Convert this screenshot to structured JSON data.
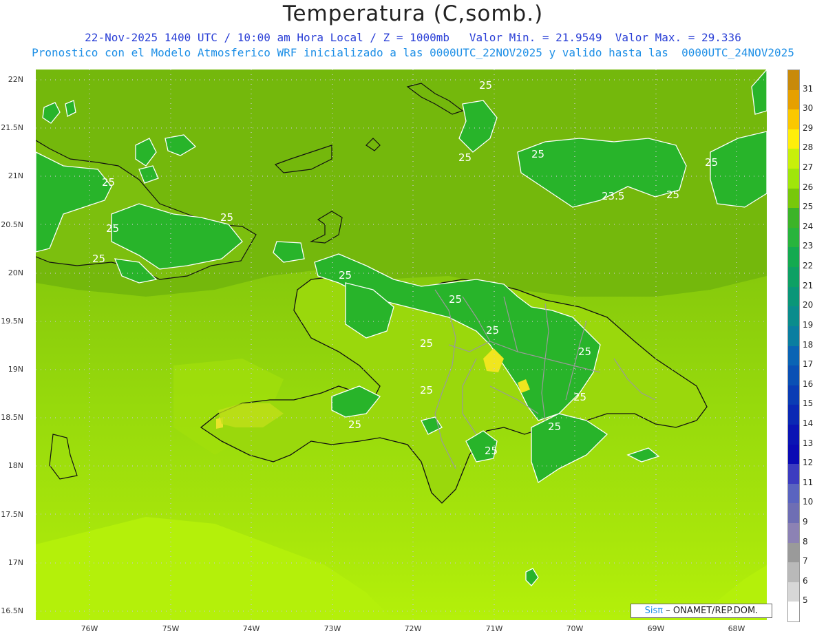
{
  "header": {
    "title": "Temperatura (C,somb.)",
    "subtitle_1": "22-Nov-2025 1400 UTC / 10:00 am Hora Local / Z = 1000mb   Valor Min. = 21.9549  Valor Max. = 29.336",
    "subtitle_2": "Pronostico con el Modelo Atmosferico WRF inicializado a las 0000UTC_22NOV2025 y valido hasta las  0000UTC_24NOV2025"
  },
  "map": {
    "lat_labels": [
      "22N",
      "21.5N",
      "21N",
      "20.5N",
      "20N",
      "19.5N",
      "19N",
      "18.5N",
      "18N",
      "17.5N",
      "17N",
      "16.5N"
    ],
    "lon_labels": [
      "76W",
      "75W",
      "74W",
      "73W",
      "72W",
      "71W",
      "70W",
      "69W",
      "68W"
    ],
    "contour_labels": [
      "25",
      "25",
      "25",
      "25",
      "25",
      "25",
      "23.5",
      "25",
      "25",
      "25",
      "25",
      "25",
      "25",
      "25",
      "25",
      "25",
      "25",
      "25",
      "25",
      "25"
    ],
    "colors": {
      "sea_south": "#b4f00a",
      "sea_mid": "#96d90c",
      "sea_north": "#74b80c",
      "land_warm": "#c0e019",
      "cool_area": "#28b42a",
      "warm_peak": "#f0e61e",
      "contour_line": "#ffffff",
      "coastline": "#111111",
      "admin_border": "#9a9a9a",
      "grid_dots": "#b0b0b0"
    }
  },
  "colorbar": {
    "labels": [
      "31",
      "30",
      "29",
      "28",
      "27",
      "26",
      "25",
      "24",
      "23",
      "22",
      "21",
      "20",
      "19",
      "18",
      "17",
      "16",
      "15",
      "14",
      "13",
      "12",
      "11",
      "10",
      "9",
      "8",
      "7",
      "6",
      "5"
    ],
    "colors": [
      "#c88a0a",
      "#e6a000",
      "#fac800",
      "#ffee0a",
      "#c8f00a",
      "#a0e60a",
      "#78c80a",
      "#3cb428",
      "#28b43c",
      "#14aa50",
      "#0ea064",
      "#0a9678",
      "#0a8c8c",
      "#0a7ea0",
      "#0a64b4",
      "#0a50b4",
      "#0a3cb4",
      "#0a28b4",
      "#0a14b4",
      "#0a0ab4",
      "#3c3cc0",
      "#5a64c0",
      "#6e6eb4",
      "#8c82b4",
      "#9a9a9a",
      "#b9b9b9",
      "#d7d7d7",
      "#ffffff"
    ]
  },
  "credit": {
    "logo": "Sisπ",
    "text": "– ONAMET/REP.DOM."
  }
}
